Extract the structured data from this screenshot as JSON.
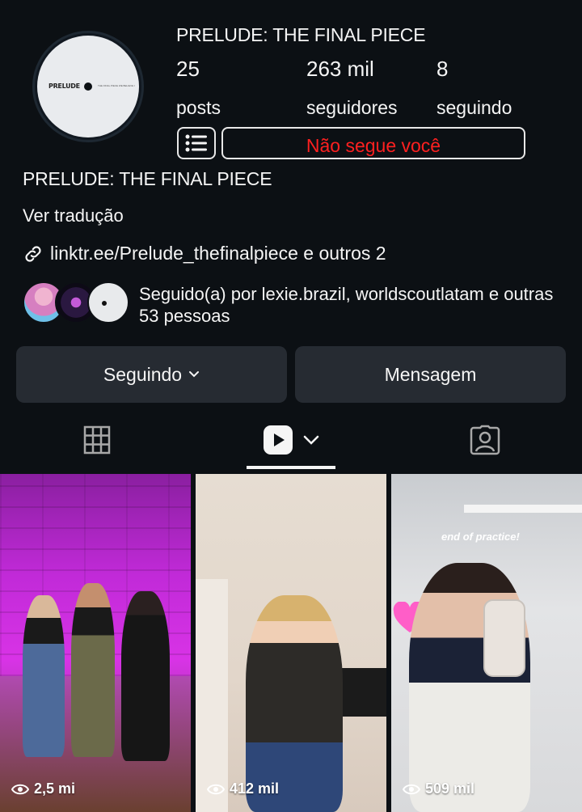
{
  "profile": {
    "name": "PRELUDE: THE FINAL PIECE",
    "avatar_label": "PRELUDE",
    "avatar_small_text": "THE FINAL PIECE WE BELIEVE IN",
    "stats": {
      "posts_count": "25",
      "posts_label": "posts",
      "followers_count": "263 mil",
      "followers_label": "seguidores",
      "following_count": "8",
      "following_label": "seguindo"
    },
    "not_following_text": "Não segue você",
    "bio_name": "PRELUDE: THE FINAL PIECE",
    "translate_text": "Ver tradução",
    "link_text": "linktr.ee/Prelude_thefinalpiece e outros 2",
    "followed_by_text": "Seguido(a) por lexie.brazil, worldscoutlatam e outras 53 pessoas"
  },
  "actions": {
    "following_label": "Seguindo",
    "message_label": "Mensagem"
  },
  "tabs": {
    "grid_icon": "grid-icon",
    "reels_icon": "reels-icon",
    "tagged_icon": "tagged-icon",
    "active": "reels"
  },
  "reels": [
    {
      "views": "2,5 mi"
    },
    {
      "views": "412 mil"
    },
    {
      "views": "509 mil",
      "overlay_text": "end of practice!"
    }
  ],
  "colors": {
    "background": "#0c1014",
    "button_bg": "#262b32",
    "warning_red": "#ff2020"
  }
}
